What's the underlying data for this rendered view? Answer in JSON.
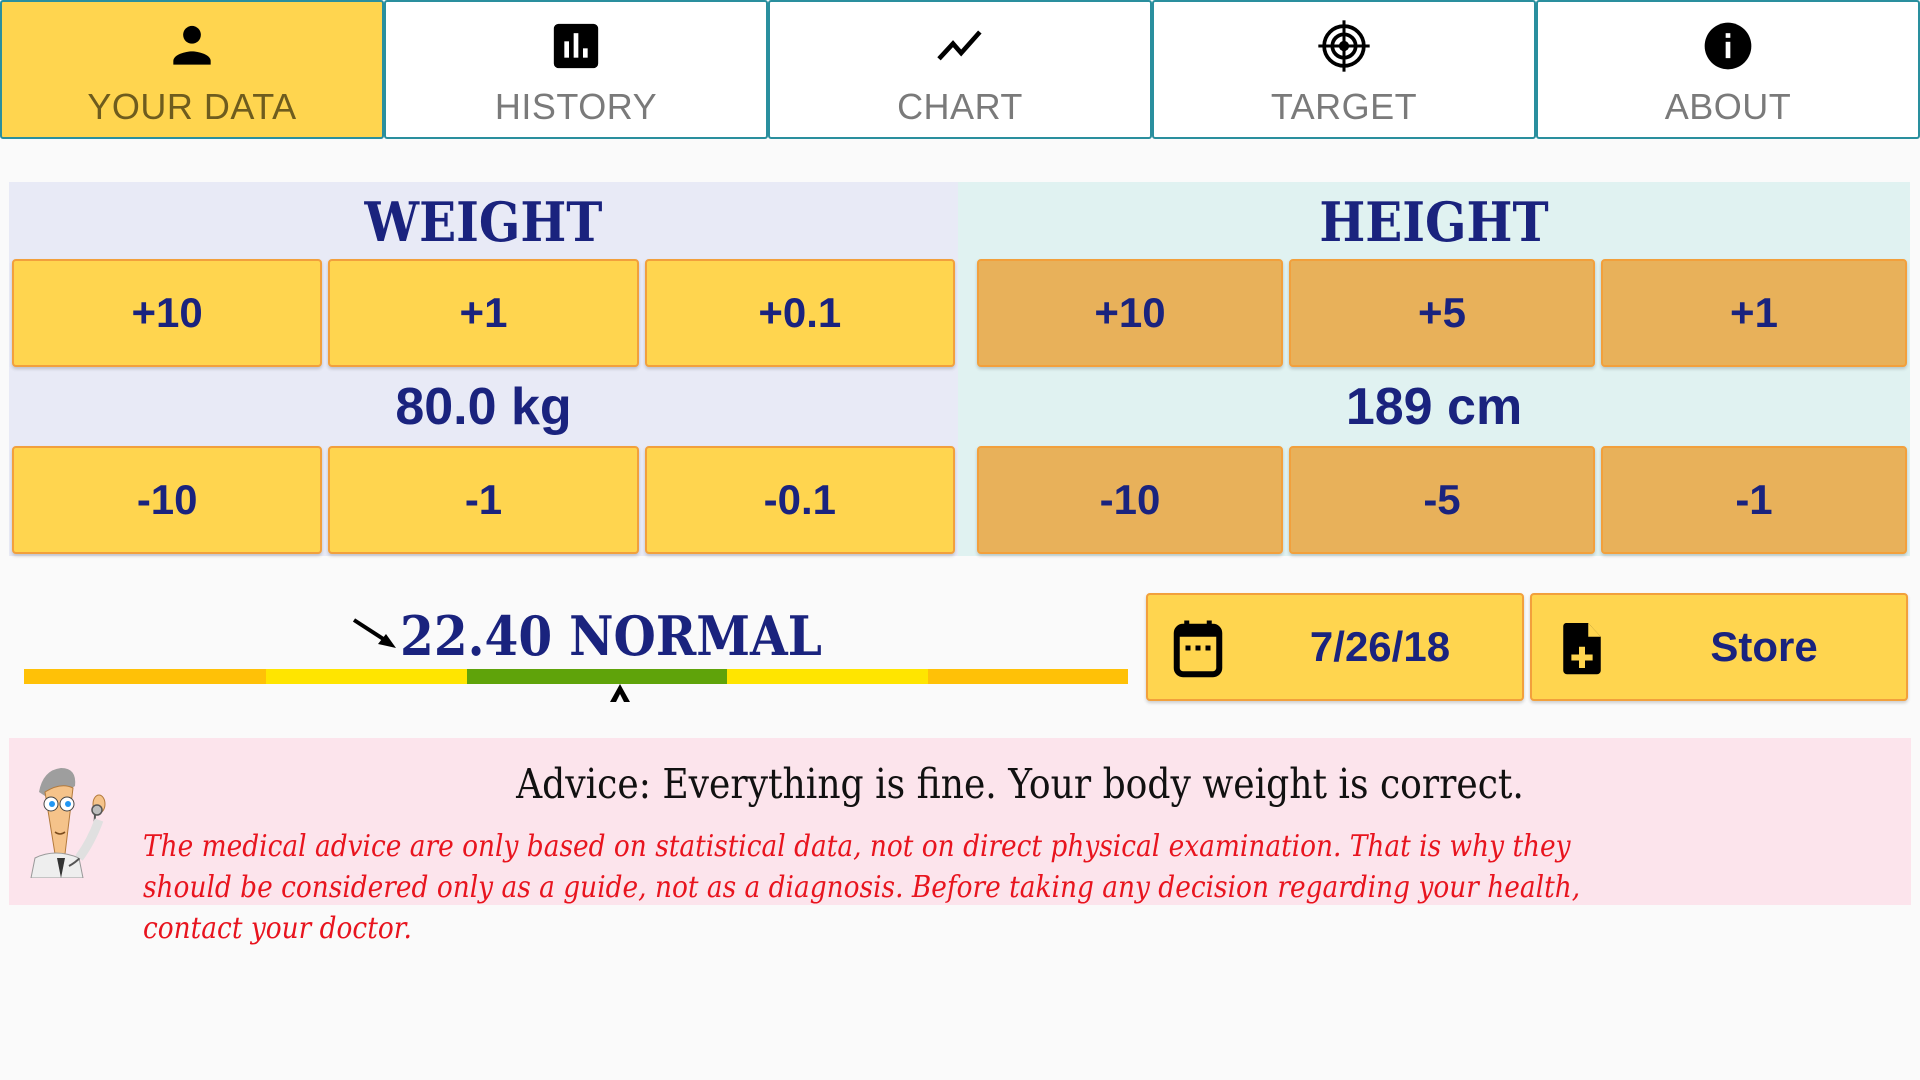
{
  "tabs": [
    {
      "label": "YOUR DATA",
      "icon": "person-icon",
      "active": true
    },
    {
      "label": "HISTORY",
      "icon": "bar-chart-icon",
      "active": false
    },
    {
      "label": "CHART",
      "icon": "trend-line-icon",
      "active": false
    },
    {
      "label": "TARGET",
      "icon": "target-icon",
      "active": false
    },
    {
      "label": "ABOUT",
      "icon": "info-icon",
      "active": false
    }
  ],
  "weight": {
    "title": "WEIGHT",
    "value": "80.0 kg",
    "increase_buttons": [
      "+10",
      "+1",
      "+0.1"
    ],
    "decrease_buttons": [
      "-10",
      "-1",
      "-0.1"
    ]
  },
  "height": {
    "title": "HEIGHT",
    "value": "189 cm",
    "increase_buttons": [
      "+10",
      "+5",
      "+1"
    ],
    "decrease_buttons": [
      "-10",
      "-5",
      "-1"
    ]
  },
  "bmi": {
    "text": "22.40 NORMAL",
    "value": 22.4,
    "category": "NORMAL",
    "pointer_fraction": 0.54,
    "scale_segments": [
      {
        "fraction": 0.219,
        "color": "#ffc107"
      },
      {
        "fraction": 0.182,
        "color": "#ffe500"
      },
      {
        "fraction": 0.236,
        "color": "#5fa30a"
      },
      {
        "fraction": 0.182,
        "color": "#ffe500"
      },
      {
        "fraction": 0.181,
        "color": "#ffc107"
      }
    ]
  },
  "actions": {
    "date_label": "7/26/18",
    "date_icon": "calendar-icon",
    "store_label": "Store",
    "store_icon": "add-file-icon"
  },
  "advice": {
    "title": "Advice: Everything is fine. Your body weight is correct.",
    "disclaimer": "The medical advice are only based on statistical data, not on direct physical examination. That is why they should be considered only as a guide, not as a diagnosis. Before taking any decision regarding your health, contact your doctor.",
    "image": "doctor-illustration"
  },
  "colors": {
    "tab_border": "#2a8f9e",
    "active_tab": "#ffd54f",
    "weight_button": "#ffd54f",
    "height_button": "#e8b15a",
    "text_primary": "#1a237e",
    "disclaimer_text": "#e8141e"
  }
}
